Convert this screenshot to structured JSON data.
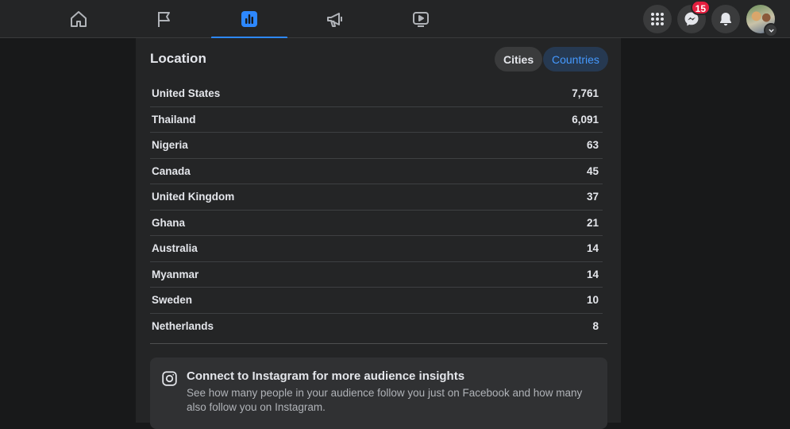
{
  "nav": {
    "tabs": [
      {
        "name": "home-icon"
      },
      {
        "name": "flag-icon"
      },
      {
        "name": "insights-icon",
        "active": true
      },
      {
        "name": "megaphone-icon"
      },
      {
        "name": "video-icon"
      }
    ],
    "messenger_badge": "15",
    "accent_color": "#2d88ff"
  },
  "location": {
    "title": "Location",
    "toggle_cities": "Cities",
    "toggle_countries": "Countries",
    "selected": "Countries",
    "rows": [
      {
        "country": "United States",
        "value": "7,761"
      },
      {
        "country": "Thailand",
        "value": "6,091"
      },
      {
        "country": "Nigeria",
        "value": "63"
      },
      {
        "country": "Canada",
        "value": "45"
      },
      {
        "country": "United Kingdom",
        "value": "37"
      },
      {
        "country": "Ghana",
        "value": "21"
      },
      {
        "country": "Australia",
        "value": "14"
      },
      {
        "country": "Myanmar",
        "value": "14"
      },
      {
        "country": "Sweden",
        "value": "10"
      },
      {
        "country": "Netherlands",
        "value": "8"
      }
    ]
  },
  "instagram": {
    "title": "Connect to Instagram for more audience insights",
    "description": "See how many people in your audience follow you just on Facebook and how many also follow you on Instagram."
  }
}
